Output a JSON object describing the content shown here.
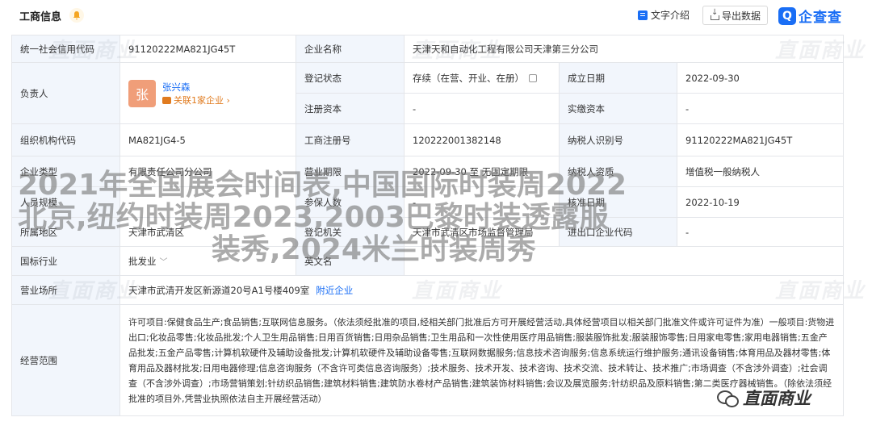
{
  "header": {
    "title": "工商信息",
    "intro_label": "文字介绍",
    "export_label": "导出数据",
    "brand_mark": "Q",
    "brand_text": "企查查"
  },
  "rows": {
    "r1": {
      "k1": "统一社会信用代码",
      "v1": "91120222MA821JG45T",
      "k2": "企业名称",
      "v2": "天津天和自动化工程有限公司天津第三分公司"
    },
    "r2": {
      "k1": "负责人",
      "person_avatar": "张",
      "person_name": "张兴森",
      "person_related": "关联1家企业 ›",
      "k2": "登记状态",
      "v2": "存续（在营、开业、在册）",
      "k3": "成立日期",
      "v3": "2022-09-30"
    },
    "r3": {
      "k2": "注册资本",
      "v2": "-",
      "k3": "实缴资本",
      "v3": "-"
    },
    "r4": {
      "k1": "组织机构代码",
      "v1": "MA821JG4-5",
      "k2": "工商注册号",
      "v2": "120222001382148",
      "k3": "纳税人识别号",
      "v3": "91120222MA821JG45T"
    },
    "r5": {
      "k1": "企业类型",
      "v1": "有限责任公司分公司",
      "k2": "营业期限",
      "v2": "2022-09-30 至 无固定期限",
      "k3": "纳税人资质",
      "v3": "增值税一般纳税人"
    },
    "r6": {
      "k1": "人员规模",
      "v1": "-",
      "k2": "参保人数",
      "v2": "-",
      "k3": "核准日期",
      "v3": "2022-10-19"
    },
    "r7": {
      "k1": "所属地区",
      "v1": "天津市武清区",
      "k2": "登记机关",
      "v2": "天津市武清区市场监督管理局",
      "k3": "进出口企业代码",
      "v3": "-"
    },
    "r8": {
      "k1": "国标行业",
      "v1": "批发业",
      "k2": "英文名",
      "v2": ""
    },
    "r9": {
      "k1": "营业场所",
      "v1": "天津市武清开发区新源道20号A1号楼409室",
      "v1_link": "附近企业"
    },
    "r10": {
      "k1": "经营范围",
      "v1": "许可项目:保健食品生产;食品销售;互联网信息服务。（依法须经批准的项目,经相关部门批准后方可开展经营活动,具体经营项目以相关部门批准文件或许可证件为准）一般项目:货物进出口;化妆品零售;化妆品批发;个人卫生用品销售;日用百货销售;日用杂品销售;卫生用品和一次性使用医疗用品销售;服装服饰批发;服装服饰零售;日用家电零售;家用电器销售;五金产品批发;五金产品零售;计算机软硬件及辅助设备批发;计算机软硬件及辅助设备零售;互联网数据服务;信息技术咨询服务;信息系统运行维护服务;通讯设备销售;体育用品及器材零售;体育用品及器材批发;日用电器修理;信息咨询服务（不含许可类信息咨询服务）;技术服务、技术开发、技术咨询、技术交流、技术转让、技术推广;市场调查（不含涉外调查）;社会调查（不含涉外调查）;市场营销策划;针纺织品销售;建筑材料销售;建筑防水卷材产品销售;建筑装饰材料销售;会议及展览服务;针纺织品及原料销售;第二类医疗器械销售。（除依法须经批准的项目外,凭营业执照依法自主开展经营活动）"
    }
  },
  "watermark_text": "直面商业",
  "overlay": {
    "line1": "2021年全国展会时间表,中国国际时装周2022",
    "line2": "北京,纽约时装周2023,2003巴黎时装透露服",
    "line3": "装秀,2024米兰时装周秀"
  },
  "wechat_label": "直面商业"
}
